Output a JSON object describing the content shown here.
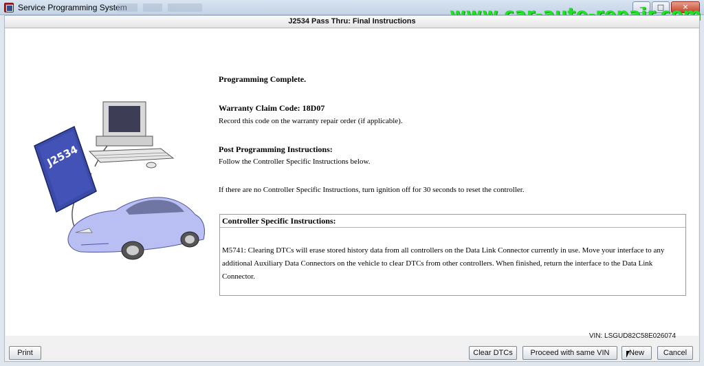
{
  "window": {
    "title": "Service Programming System",
    "controls": {
      "minimize": "–",
      "maximize": "□",
      "close": "✕"
    }
  },
  "watermark": "www.car-auto-repair.com",
  "header": {
    "title": "J2534 Pass Thru: Final Instructions"
  },
  "illustration": {
    "device_label": "J2534",
    "icons": [
      "computer-icon",
      "j2534-device-icon",
      "car-icon"
    ]
  },
  "main": {
    "status": "Programming Complete.",
    "warranty_heading": "Warranty Claim Code: 18D07",
    "warranty_text": "Record this code on the warranty repair order (if applicable).",
    "post_heading": "Post Programming Instructions:",
    "post_text": "Follow the Controller Specific Instructions below.",
    "ignition_text": "If there are no Controller Specific Instructions, turn ignition off for 30 seconds to reset the controller.",
    "controller_box": {
      "heading": "Controller Specific Instructions:",
      "body": "M5741: Clearing DTCs will erase stored history data from all controllers on the Data Link Connector currently in use. Move your interface to any additional Auxiliary Data Connectors on the vehicle to clear DTCs from other controllers. When finished, return the interface to the Data Link Connector."
    }
  },
  "footer": {
    "vin": "VIN: LSGUD82C58E026074",
    "buttons": {
      "print": "Print",
      "clear_dtcs": "Clear DTCs",
      "proceed_same_vin": "Proceed with same VIN",
      "new": "New",
      "cancel": "Cancel"
    }
  },
  "colors": {
    "watermark": "#22e02a",
    "device_blue": "#3a4aa8",
    "car_body": "#b9bff2"
  }
}
